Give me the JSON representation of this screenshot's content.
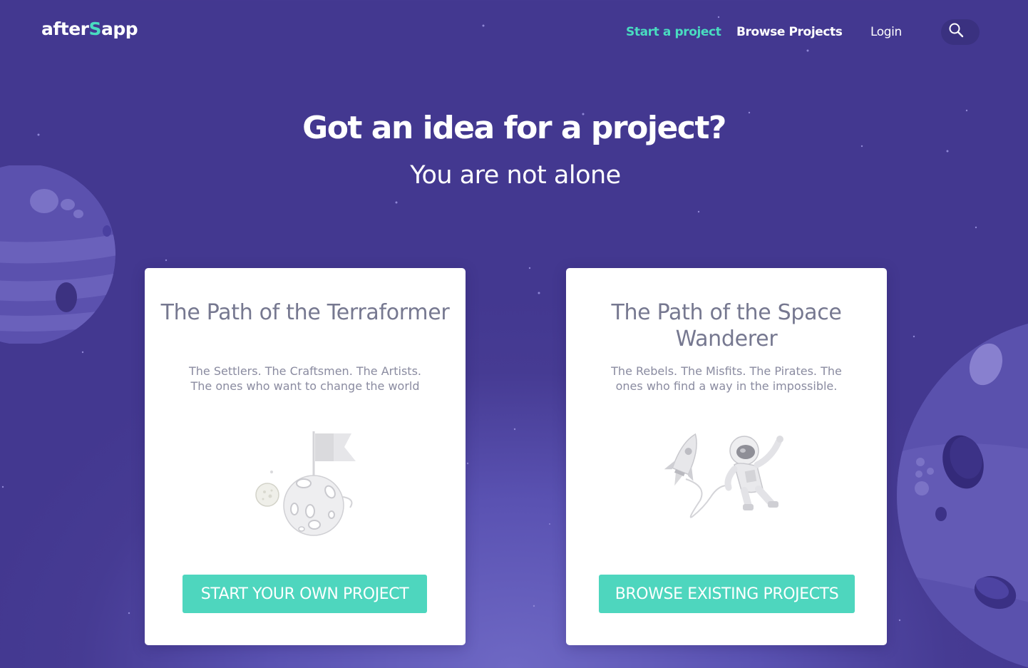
{
  "header": {
    "logo_left": "after",
    "logo_accent": "S",
    "logo_right": "app",
    "nav": {
      "start_project": "Start a project",
      "browse_projects": "Browse Projects",
      "login": "Login"
    },
    "search_icon": "search-icon"
  },
  "hero": {
    "title": "Got an idea for a project?",
    "subtitle": "You are not alone"
  },
  "cards": [
    {
      "title": "The Path of the Terraformer",
      "description": "The Settlers. The Craftsmen. The Artists. The ones who want to change the world",
      "illustration": "moon-flag-illustration",
      "button": "START YOUR OWN PROJECT"
    },
    {
      "title": "The Path of the Space Wanderer",
      "description": "The Rebels. The Misfits. The Pirates. The ones who find a way in the impossible.",
      "illustration": "rocket-astronaut-illustration",
      "button": "BROWSE EXISTING PROJECTS"
    }
  ],
  "colors": {
    "background": "#433890",
    "accent": "#49dcc0",
    "button": "#4ed6be",
    "card_text": "#767890"
  }
}
